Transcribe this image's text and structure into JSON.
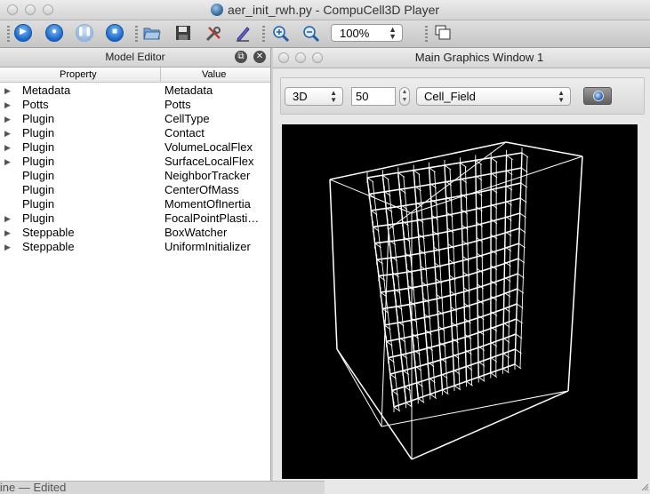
{
  "window": {
    "title": "aer_init_rwh.py - CompuCell3D Player",
    "traffic_lights": [
      "close",
      "minimize",
      "zoom"
    ]
  },
  "toolbar": {
    "buttons": [
      {
        "name": "run-step-button",
        "icon": "step-icon"
      },
      {
        "name": "run-button",
        "icon": "play-icon"
      },
      {
        "name": "pause-button",
        "icon": "pause-icon"
      },
      {
        "name": "stop-button",
        "icon": "stop-icon"
      },
      {
        "name": "open-button",
        "icon": "folder-icon"
      },
      {
        "name": "save-button",
        "icon": "floppy-icon"
      },
      {
        "name": "tools-button",
        "icon": "wrench-icon"
      },
      {
        "name": "edit-button",
        "icon": "pencil-icon"
      },
      {
        "name": "zoom-in-button",
        "icon": "zoom-in-icon"
      },
      {
        "name": "zoom-out-button",
        "icon": "zoom-out-icon"
      }
    ],
    "zoom_value": "100%"
  },
  "model_editor": {
    "title": "Model Editor",
    "columns": [
      "Property",
      "Value"
    ],
    "rows": [
      {
        "property": "Metadata",
        "value": "Metadata",
        "expandable": true
      },
      {
        "property": "Potts",
        "value": "Potts",
        "expandable": true
      },
      {
        "property": "Plugin",
        "value": "CellType",
        "expandable": true
      },
      {
        "property": "Plugin",
        "value": "Contact",
        "expandable": true
      },
      {
        "property": "Plugin",
        "value": "VolumeLocalFlex",
        "expandable": true
      },
      {
        "property": "Plugin",
        "value": "SurfaceLocalFlex",
        "expandable": true
      },
      {
        "property": "Plugin",
        "value": "NeighborTracker",
        "expandable": false
      },
      {
        "property": "Plugin",
        "value": "CenterOfMass",
        "expandable": false
      },
      {
        "property": "Plugin",
        "value": "MomentOfInertia",
        "expandable": false
      },
      {
        "property": "Plugin",
        "value": "FocalPointPlasti…",
        "expandable": true
      },
      {
        "property": "Steppable",
        "value": "BoxWatcher",
        "expandable": true
      },
      {
        "property": "Steppable",
        "value": "UniformInitializer",
        "expandable": true
      }
    ]
  },
  "graphics": {
    "title": "Main Graphics Window 1",
    "view_mode": "3D",
    "slice_value": "50",
    "field": "Cell_Field"
  },
  "status": {
    "partial_text": "line — Edited"
  },
  "colors": {
    "canvas_bg": "#000000",
    "wireframe": "#ffffff",
    "accent_blue": "#1766c9"
  }
}
